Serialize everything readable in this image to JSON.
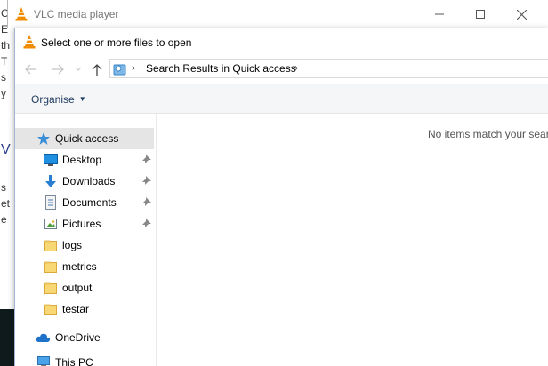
{
  "app": {
    "title": "VLC media player"
  },
  "dialog": {
    "title": "Select one or more files to open",
    "address": {
      "breadcrumb": "Search Results in Quick access"
    },
    "toolbar": {
      "organise_label": "Organise"
    },
    "nav": {
      "quick_access": "Quick access",
      "pinned": [
        {
          "label": "Desktop",
          "icon": "desktop-icon"
        },
        {
          "label": "Downloads",
          "icon": "downloads-icon"
        },
        {
          "label": "Documents",
          "icon": "documents-icon"
        },
        {
          "label": "Pictures",
          "icon": "pictures-icon"
        }
      ],
      "folders": [
        {
          "label": "logs"
        },
        {
          "label": "metrics"
        },
        {
          "label": "output"
        },
        {
          "label": "testar"
        }
      ],
      "onedrive": "OneDrive",
      "this_pc": "This PC"
    },
    "content": {
      "empty_message": "No items match your sear"
    }
  },
  "background": {
    "chars": [
      "C",
      "E",
      "th",
      "T",
      "s",
      "y",
      "V",
      "s",
      "et",
      "e"
    ]
  },
  "colors": {
    "accent": "#1e3a5f",
    "selected": "#e5e5e5",
    "vlc_orange": "#f08c00"
  }
}
